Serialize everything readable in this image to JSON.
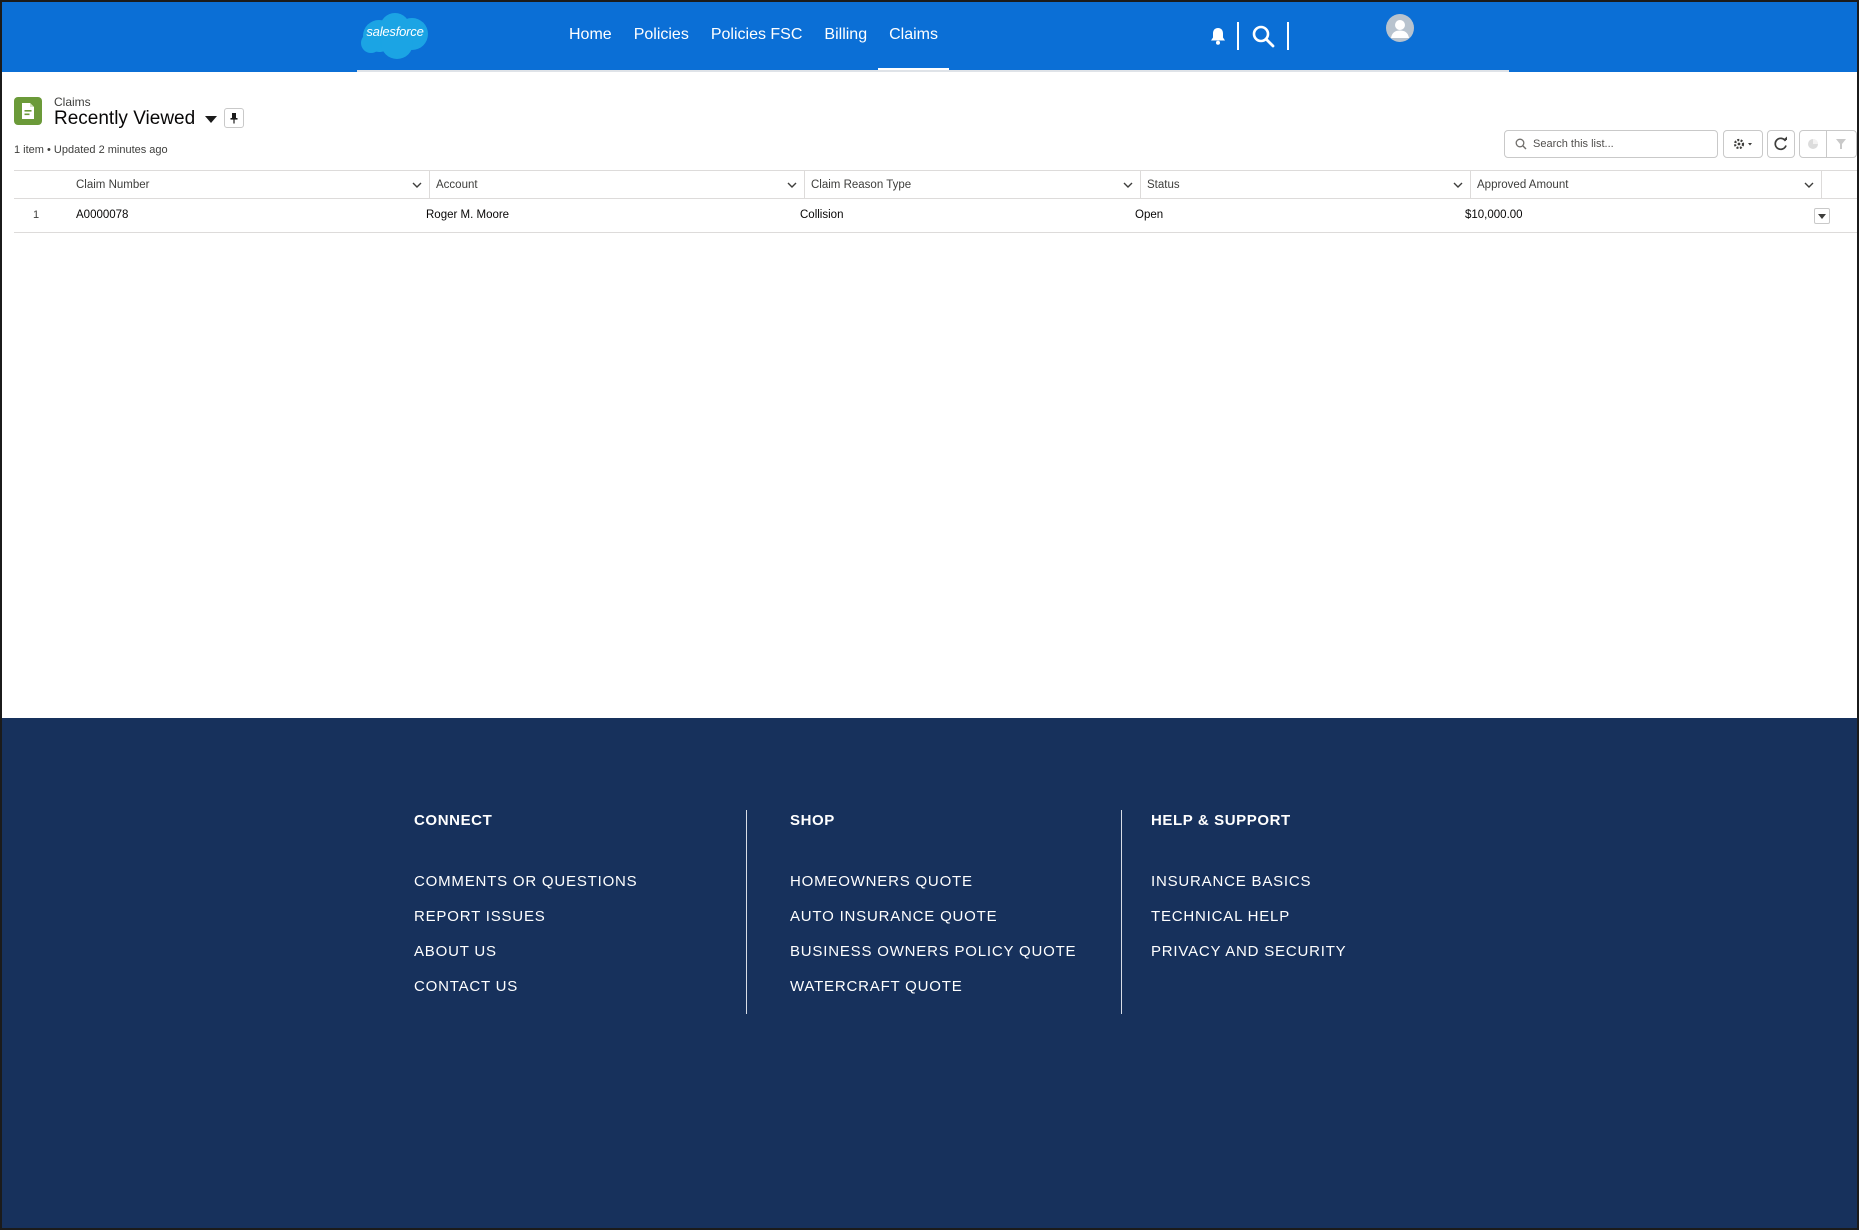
{
  "header": {
    "logo_text": "salesforce",
    "nav": [
      {
        "label": "Home",
        "active": false
      },
      {
        "label": "Policies",
        "active": false
      },
      {
        "label": "Policies FSC",
        "active": false
      },
      {
        "label": "Billing",
        "active": false
      },
      {
        "label": "Claims",
        "active": true
      }
    ],
    "icons": [
      "bell-icon",
      "search-icon",
      "user-avatar-icon"
    ]
  },
  "list_view": {
    "object_label": "Claims",
    "title": "Recently Viewed",
    "meta": "1 item • Updated 2 minutes ago",
    "search_placeholder": "Search this list...",
    "toolbar_icons": [
      "gear-icon",
      "refresh-icon",
      "chart-icon",
      "filter-icon"
    ],
    "columns": [
      "Claim Number",
      "Account",
      "Claim Reason Type",
      "Status",
      "Approved Amount"
    ],
    "rows": [
      {
        "num": "1",
        "claim_number": "A0000078",
        "account": "Roger M. Moore",
        "reason": "Collision",
        "status": "Open",
        "amount": "$10,000.00"
      }
    ]
  },
  "footer": {
    "columns": [
      {
        "heading": "CONNECT",
        "links": [
          "COMMENTS OR QUESTIONS",
          "REPORT ISSUES",
          "ABOUT US",
          "CONTACT US"
        ]
      },
      {
        "heading": "SHOP",
        "links": [
          "HOMEOWNERS QUOTE",
          "AUTO INSURANCE QUOTE",
          "BUSINESS OWNERS POLICY QUOTE",
          "WATERCRAFT QUOTE"
        ]
      },
      {
        "heading": "HELP & SUPPORT",
        "links": [
          "INSURANCE BASICS",
          "TECHNICAL HELP",
          "PRIVACY AND SECURITY"
        ]
      }
    ]
  },
  "colors": {
    "header_blue": "#0b6fd6",
    "footer_navy": "#17315c",
    "claims_icon_green": "#6b9a39"
  }
}
